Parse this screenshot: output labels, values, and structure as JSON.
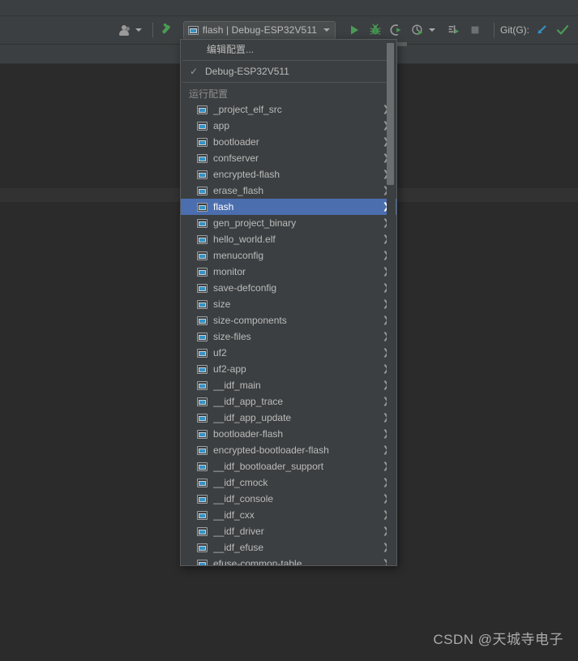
{
  "window": {
    "background_color": "#2b2b2b",
    "chrome_color": "#3c3f41"
  },
  "toolbar": {
    "user_icon": "user-avatar-icon",
    "build_icon": "build-hammer-icon",
    "run_config_selector": {
      "icon": "application-run-icon",
      "label": "flash | Debug-ESP32V511",
      "dropdown_icon": "chevron-down-icon"
    },
    "actions": [
      {
        "name": "run-button",
        "icon": "run-play-icon",
        "label": "Run"
      },
      {
        "name": "debug-button",
        "icon": "debug-bug-icon",
        "label": "Debug"
      },
      {
        "name": "run-with-coverage-button",
        "icon": "coverage-icon",
        "label": "Run with Coverage"
      },
      {
        "name": "profile-button",
        "icon": "profiler-clock-icon",
        "label": "Profile"
      },
      {
        "name": "profile-dropdown",
        "icon": "chevron-down-icon",
        "label": "More"
      },
      {
        "name": "attach-process-button",
        "icon": "attach-debugger-icon",
        "label": "Attach to Process"
      },
      {
        "name": "stop-button",
        "icon": "stop-square-icon",
        "label": "Stop"
      }
    ],
    "git": {
      "label": "Git(G):",
      "update_icon": "update-project-arrow-icon",
      "commit_icon": "commit-checkmark-icon"
    }
  },
  "menu": {
    "edit_configurations": "编辑配置...",
    "current": {
      "check_glyph": "✓",
      "label": "Debug-ESP32V511"
    },
    "group_header": "运行配置",
    "submenu_arrow": "❯",
    "selected_item": "flash",
    "items": [
      "_project_elf_src",
      "app",
      "bootloader",
      "confserver",
      "encrypted-flash",
      "erase_flash",
      "flash",
      "gen_project_binary",
      "hello_world.elf",
      "menuconfig",
      "monitor",
      "save-defconfig",
      "size",
      "size-components",
      "size-files",
      "uf2",
      "uf2-app",
      "__idf_main",
      "__idf_app_trace",
      "__idf_app_update",
      "bootloader-flash",
      "encrypted-bootloader-flash",
      "__idf_bootloader_support",
      "__idf_cmock",
      "__idf_console",
      "__idf_cxx",
      "__idf_driver",
      "__idf_efuse",
      "efuse-common-table"
    ]
  },
  "watermark": {
    "text": "CSDN @天城寺电子"
  },
  "colors": {
    "selection_blue": "#4b6eaf",
    "accent_green": "#499c54",
    "accent_blue": "#3592c4",
    "text_primary": "#bbbbbb",
    "text_dim": "#8d8d8d"
  }
}
